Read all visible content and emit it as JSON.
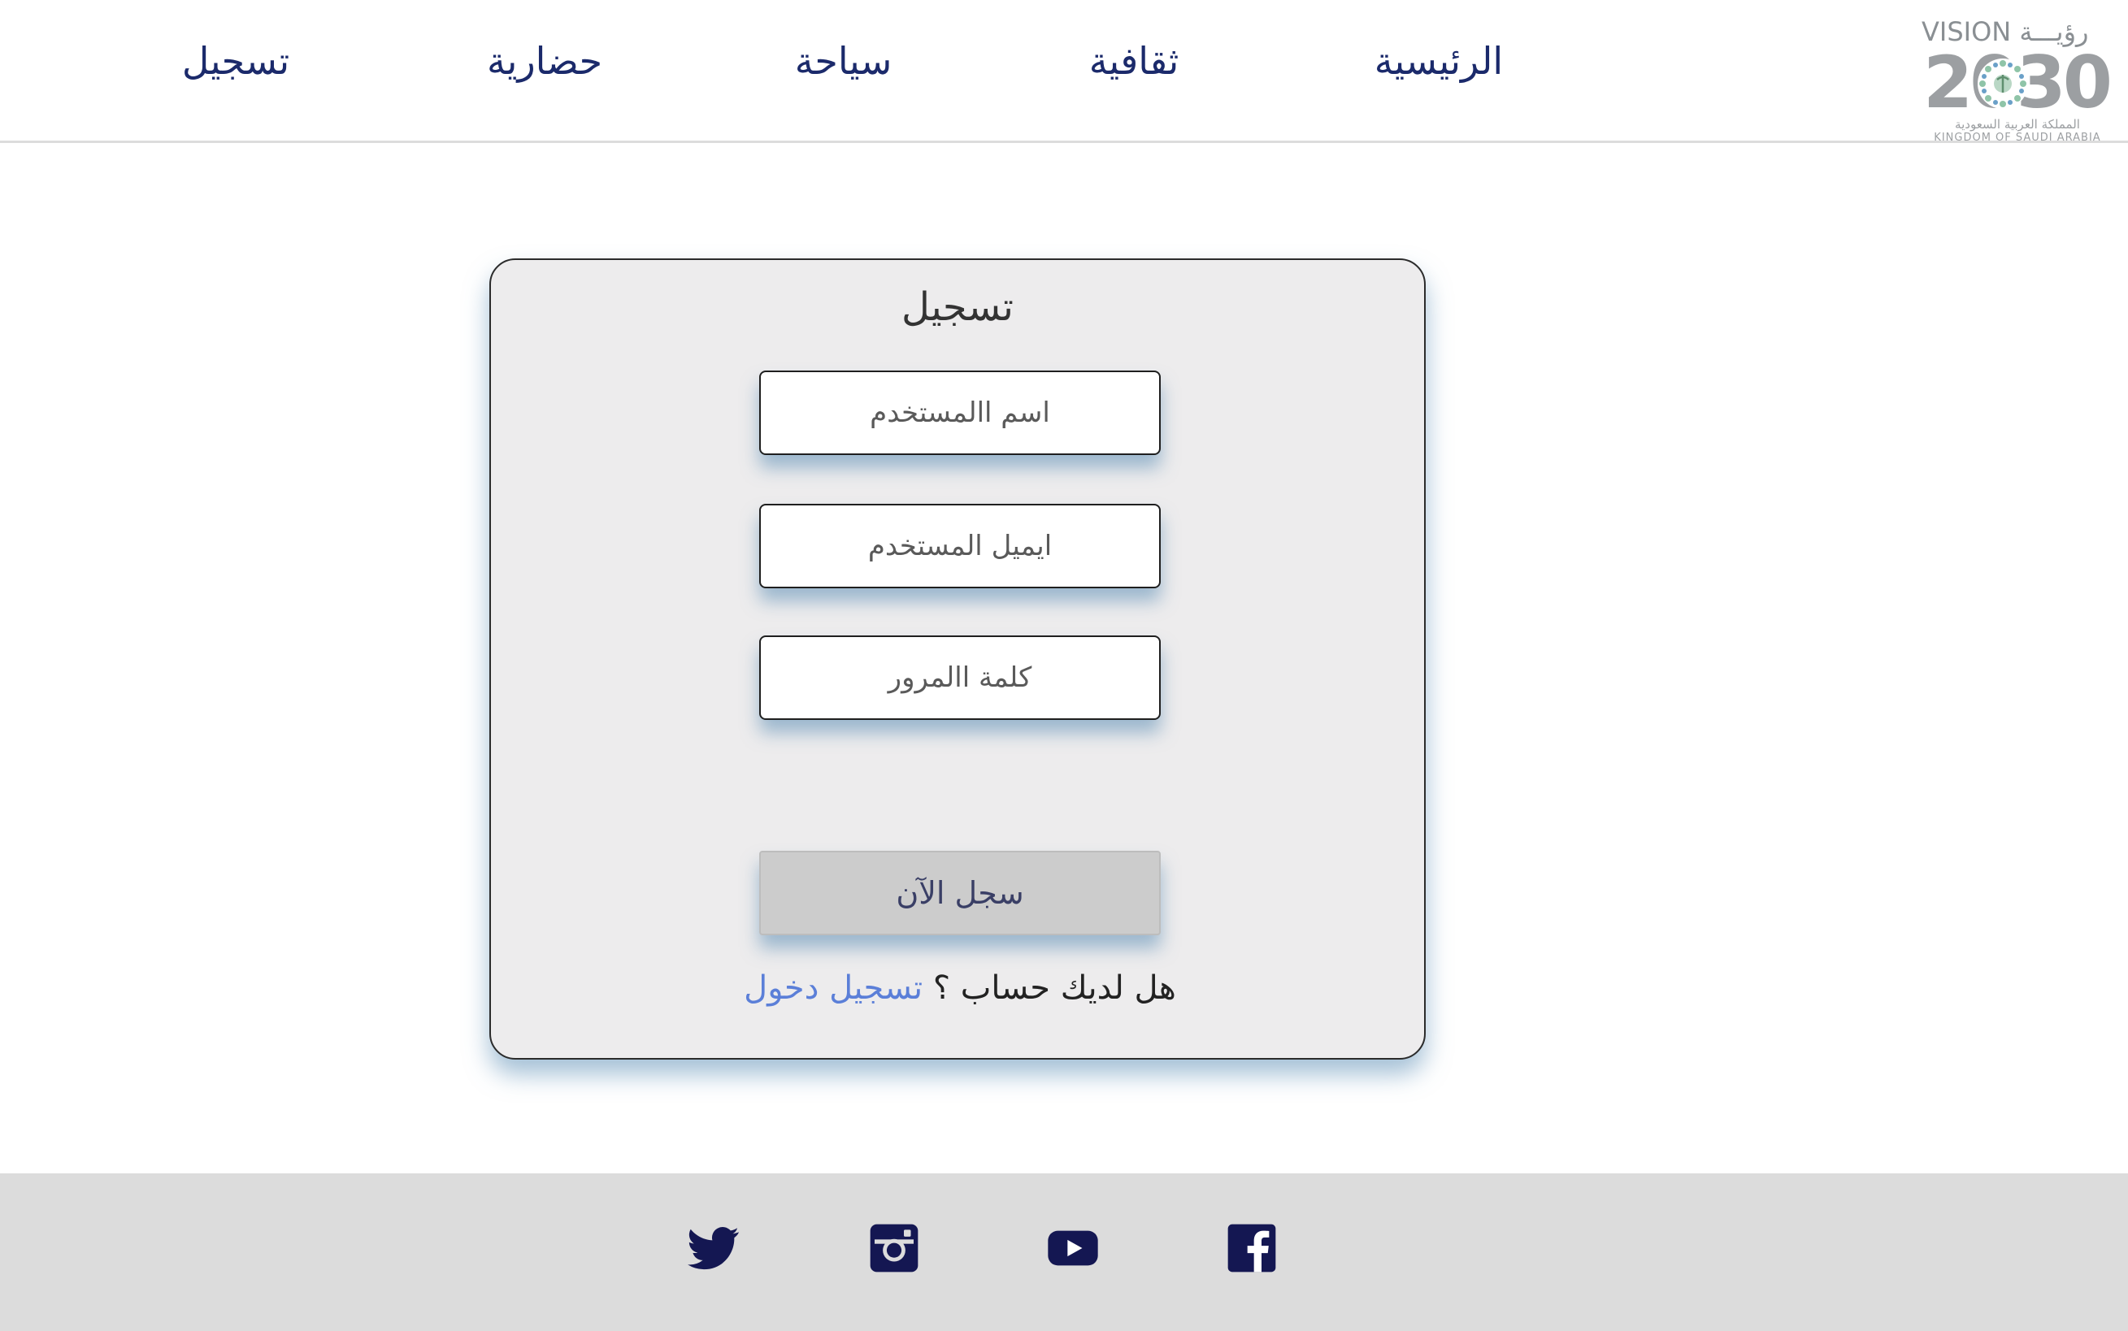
{
  "nav": {
    "home": "الرئيسية",
    "culture": "ثقافية",
    "tourism": "سياحة",
    "heritage": "حضارية",
    "register": "تسجيل"
  },
  "logo": {
    "vision": "VISION رؤيـــة",
    "year": "2030",
    "arabic": "المملكة العربية السعودية",
    "english": "KINGDOM OF SAUDI ARABIA"
  },
  "form": {
    "title": "تسجيل",
    "username_placeholder": "اسم االمستخدم",
    "email_placeholder": "ايميل المستخدم",
    "password_placeholder": "كلمة االمرور",
    "submit_label": "سجل الآن",
    "login_question": "هل لديك حساب ؟ ",
    "login_link": "تسجيل دخول"
  },
  "footer": {
    "icons": [
      "twitter-icon",
      "instagram-icon",
      "youtube-icon",
      "facebook-icon"
    ]
  },
  "colors": {
    "nav_text": "#1b2a6b",
    "card_bg": "#edeced",
    "link": "#5b7fd8",
    "social_icons": "#141752",
    "footer_bg": "#dcdcdc"
  }
}
